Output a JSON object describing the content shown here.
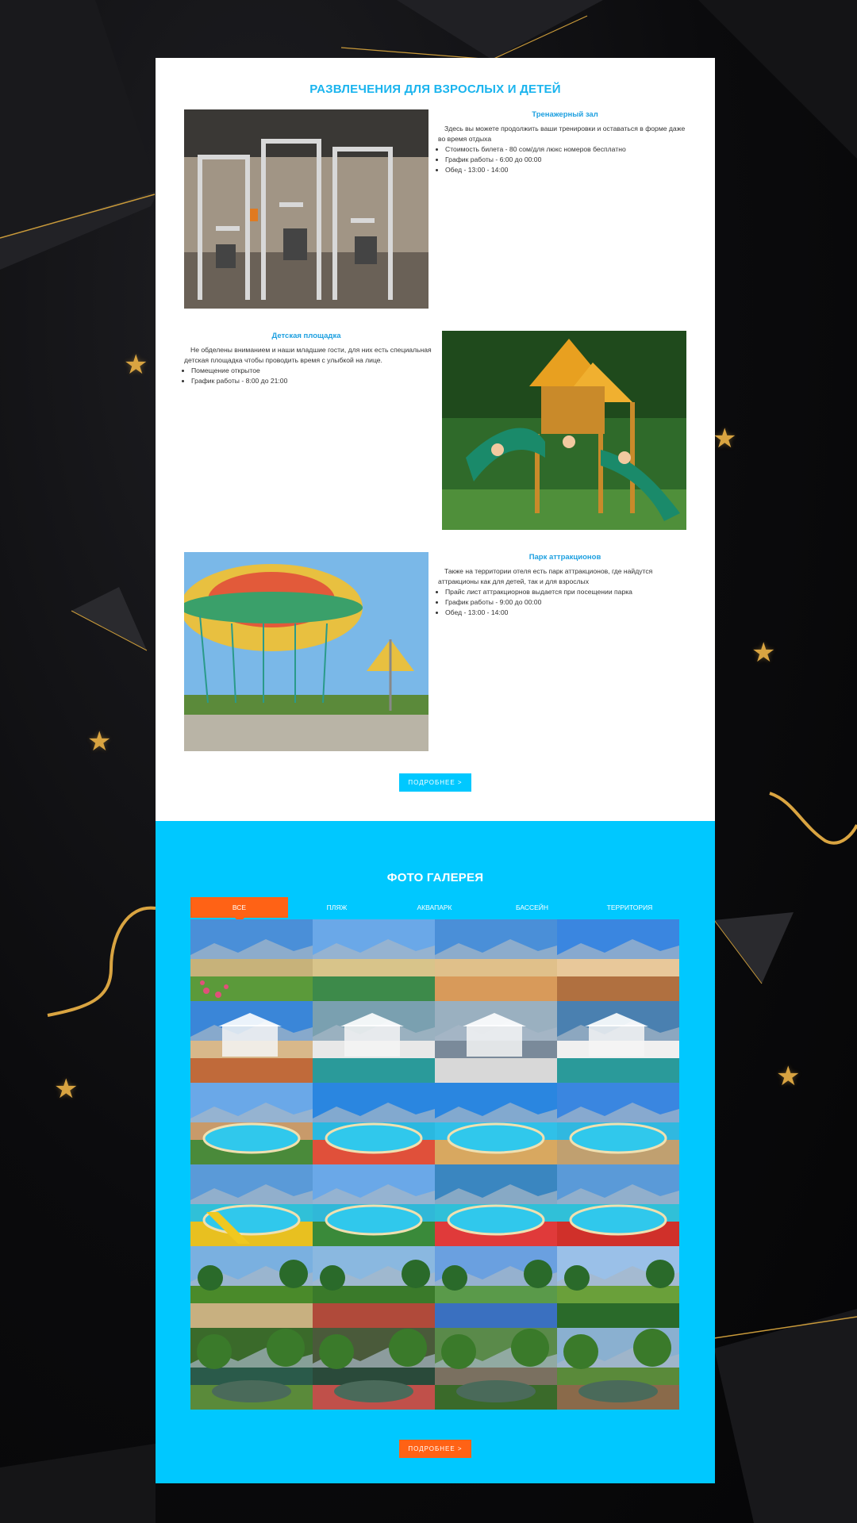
{
  "entertainment": {
    "title": "РАЗВЛЕЧЕНИЯ ДЛЯ ВЗРОСЛЫХ И ДЕТЕЙ",
    "gym": {
      "title": "Тренажерный зал",
      "intro": "Здесь вы можете продолжить ваши тренировки и оставаться в форме даже во время отдыха",
      "items": [
        "Стоимость билета - 80 сом/для люкс номеров бесплатно",
        "График работы - 6:00 до 00:00",
        "Обед - 13:00 - 14:00"
      ]
    },
    "playground": {
      "title": "Детская площадка",
      "intro": "Не обделены вниманием и наши младшие гости, для них есть специальная детская площадка чтобы проводить время с улыбкой на лице.",
      "items": [
        "Помещение открытое",
        "График работы - 8:00 до 21:00"
      ]
    },
    "park": {
      "title": "Парк аттракционов",
      "intro": "Также на территории отеля есть парк аттракционов, где найдутся аттракционы как для детей, так и для взрослых",
      "items": [
        "Прайс лист аттракциорнов выдается при посещении парка",
        "График работы - 9:00 до 00:00",
        "Обед - 13:00 - 14:00"
      ]
    },
    "more_button": "ПОДРОБНЕЕ >"
  },
  "gallery": {
    "title": "ФОТО ГАЛЕРЕЯ",
    "tabs": [
      "ВСЕ",
      "ПЛЯЖ",
      "АКВАПАРК",
      "БАССЕЙН",
      "ТЕРРИТОРИЯ"
    ],
    "active_tab": "ВСЕ",
    "more_button": "ПОДРОБНЕЕ >",
    "photos": [
      "flower-path",
      "beach-umbrellas",
      "sand-beach",
      "beach-fence",
      "hotel-beach",
      "white-gazebo",
      "lake-gazebo",
      "cabanas",
      "garden-building",
      "water-slides",
      "round-pool",
      "pool-loungers",
      "slides-pool",
      "pool-mountains",
      "aquapark",
      "red-slide",
      "garden-alley",
      "red-house",
      "blue-gate",
      "green-lawn",
      "pond-garden",
      "water-lilies",
      "rock-garden",
      "wooden-gazebo"
    ]
  },
  "colors": {
    "accent_blue": "#00c8ff",
    "title_blue": "#1ea0e0",
    "accent_orange": "#ff6215",
    "gold": "#d9a441"
  }
}
